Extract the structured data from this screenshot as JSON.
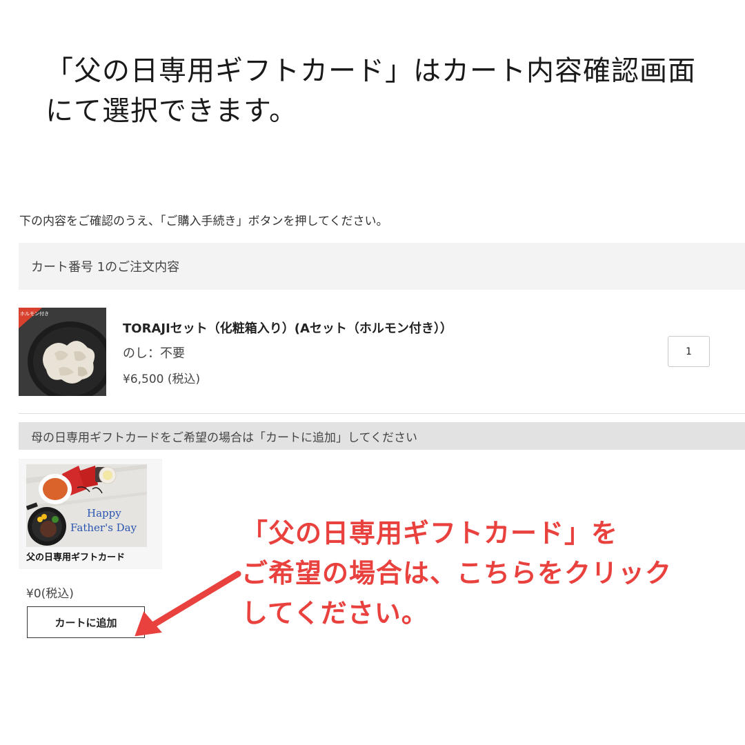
{
  "headline": {
    "line1": "「父の日専用ギフトカード」はカート内容確認画面",
    "line2": "にて選択できます。"
  },
  "instruction": "下の内容をご確認のうえ、「ご購入手続き」ボタンを押してください。",
  "cart": {
    "header": "カート番号 1のご注文内容",
    "item": {
      "thumb_tag": "ホルモン付き",
      "name": "TORAJIセット（化粧箱入り）(Aセット（ホルモン付き））",
      "noshi": "のし：不要",
      "price": "¥6,500 (税込)",
      "quantity": "1"
    }
  },
  "gift": {
    "banner": "母の日専用ギフトカードをご希望の場合は「カートに追加」してください",
    "card_image_text_1": "Happy",
    "card_image_text_2": "Father's Day",
    "card_label": "父の日専用ギフトカード",
    "price": "¥0(税込)",
    "add_button": "カートに追加"
  },
  "callout": {
    "line1": "「父の日専用ギフトカード」を",
    "line2": "ご希望の場合は、こちらをクリック",
    "line3": "してください。"
  },
  "colors": {
    "callout_red": "#e8413e",
    "header_bg": "#f3f3f3",
    "banner_bg": "#e2e2e2",
    "card_text_blue": "#2a55b0"
  }
}
